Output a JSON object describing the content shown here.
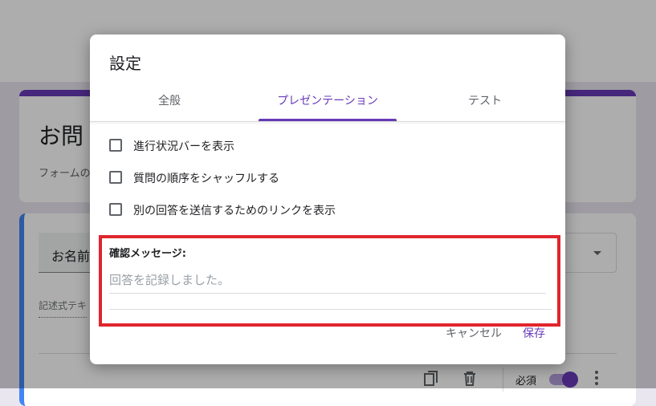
{
  "background": {
    "form_title": "お問",
    "form_description": "フォームの",
    "question_field": "お名前",
    "question_type": "記述式テキ",
    "required_label": "必須",
    "icons": [
      "copy-icon",
      "delete-icon",
      "more-vert-icon"
    ]
  },
  "dialog": {
    "title": "設定",
    "tabs": [
      {
        "label": "全般",
        "active": false
      },
      {
        "label": "プレゼンテーション",
        "active": true
      },
      {
        "label": "テスト",
        "active": false
      }
    ],
    "options": [
      {
        "label": "進行状況バーを表示",
        "checked": false
      },
      {
        "label": "質問の順序をシャッフルする",
        "checked": false
      },
      {
        "label": "別の回答を送信するためのリンクを表示",
        "checked": false
      }
    ],
    "confirmation": {
      "label": "確認メッセージ:",
      "placeholder": "回答を記録しました。"
    },
    "buttons": {
      "cancel": "キャンセル",
      "save": "保存"
    }
  },
  "colors": {
    "accent": "#673ab7",
    "highlight_frame": "#e0252d"
  }
}
